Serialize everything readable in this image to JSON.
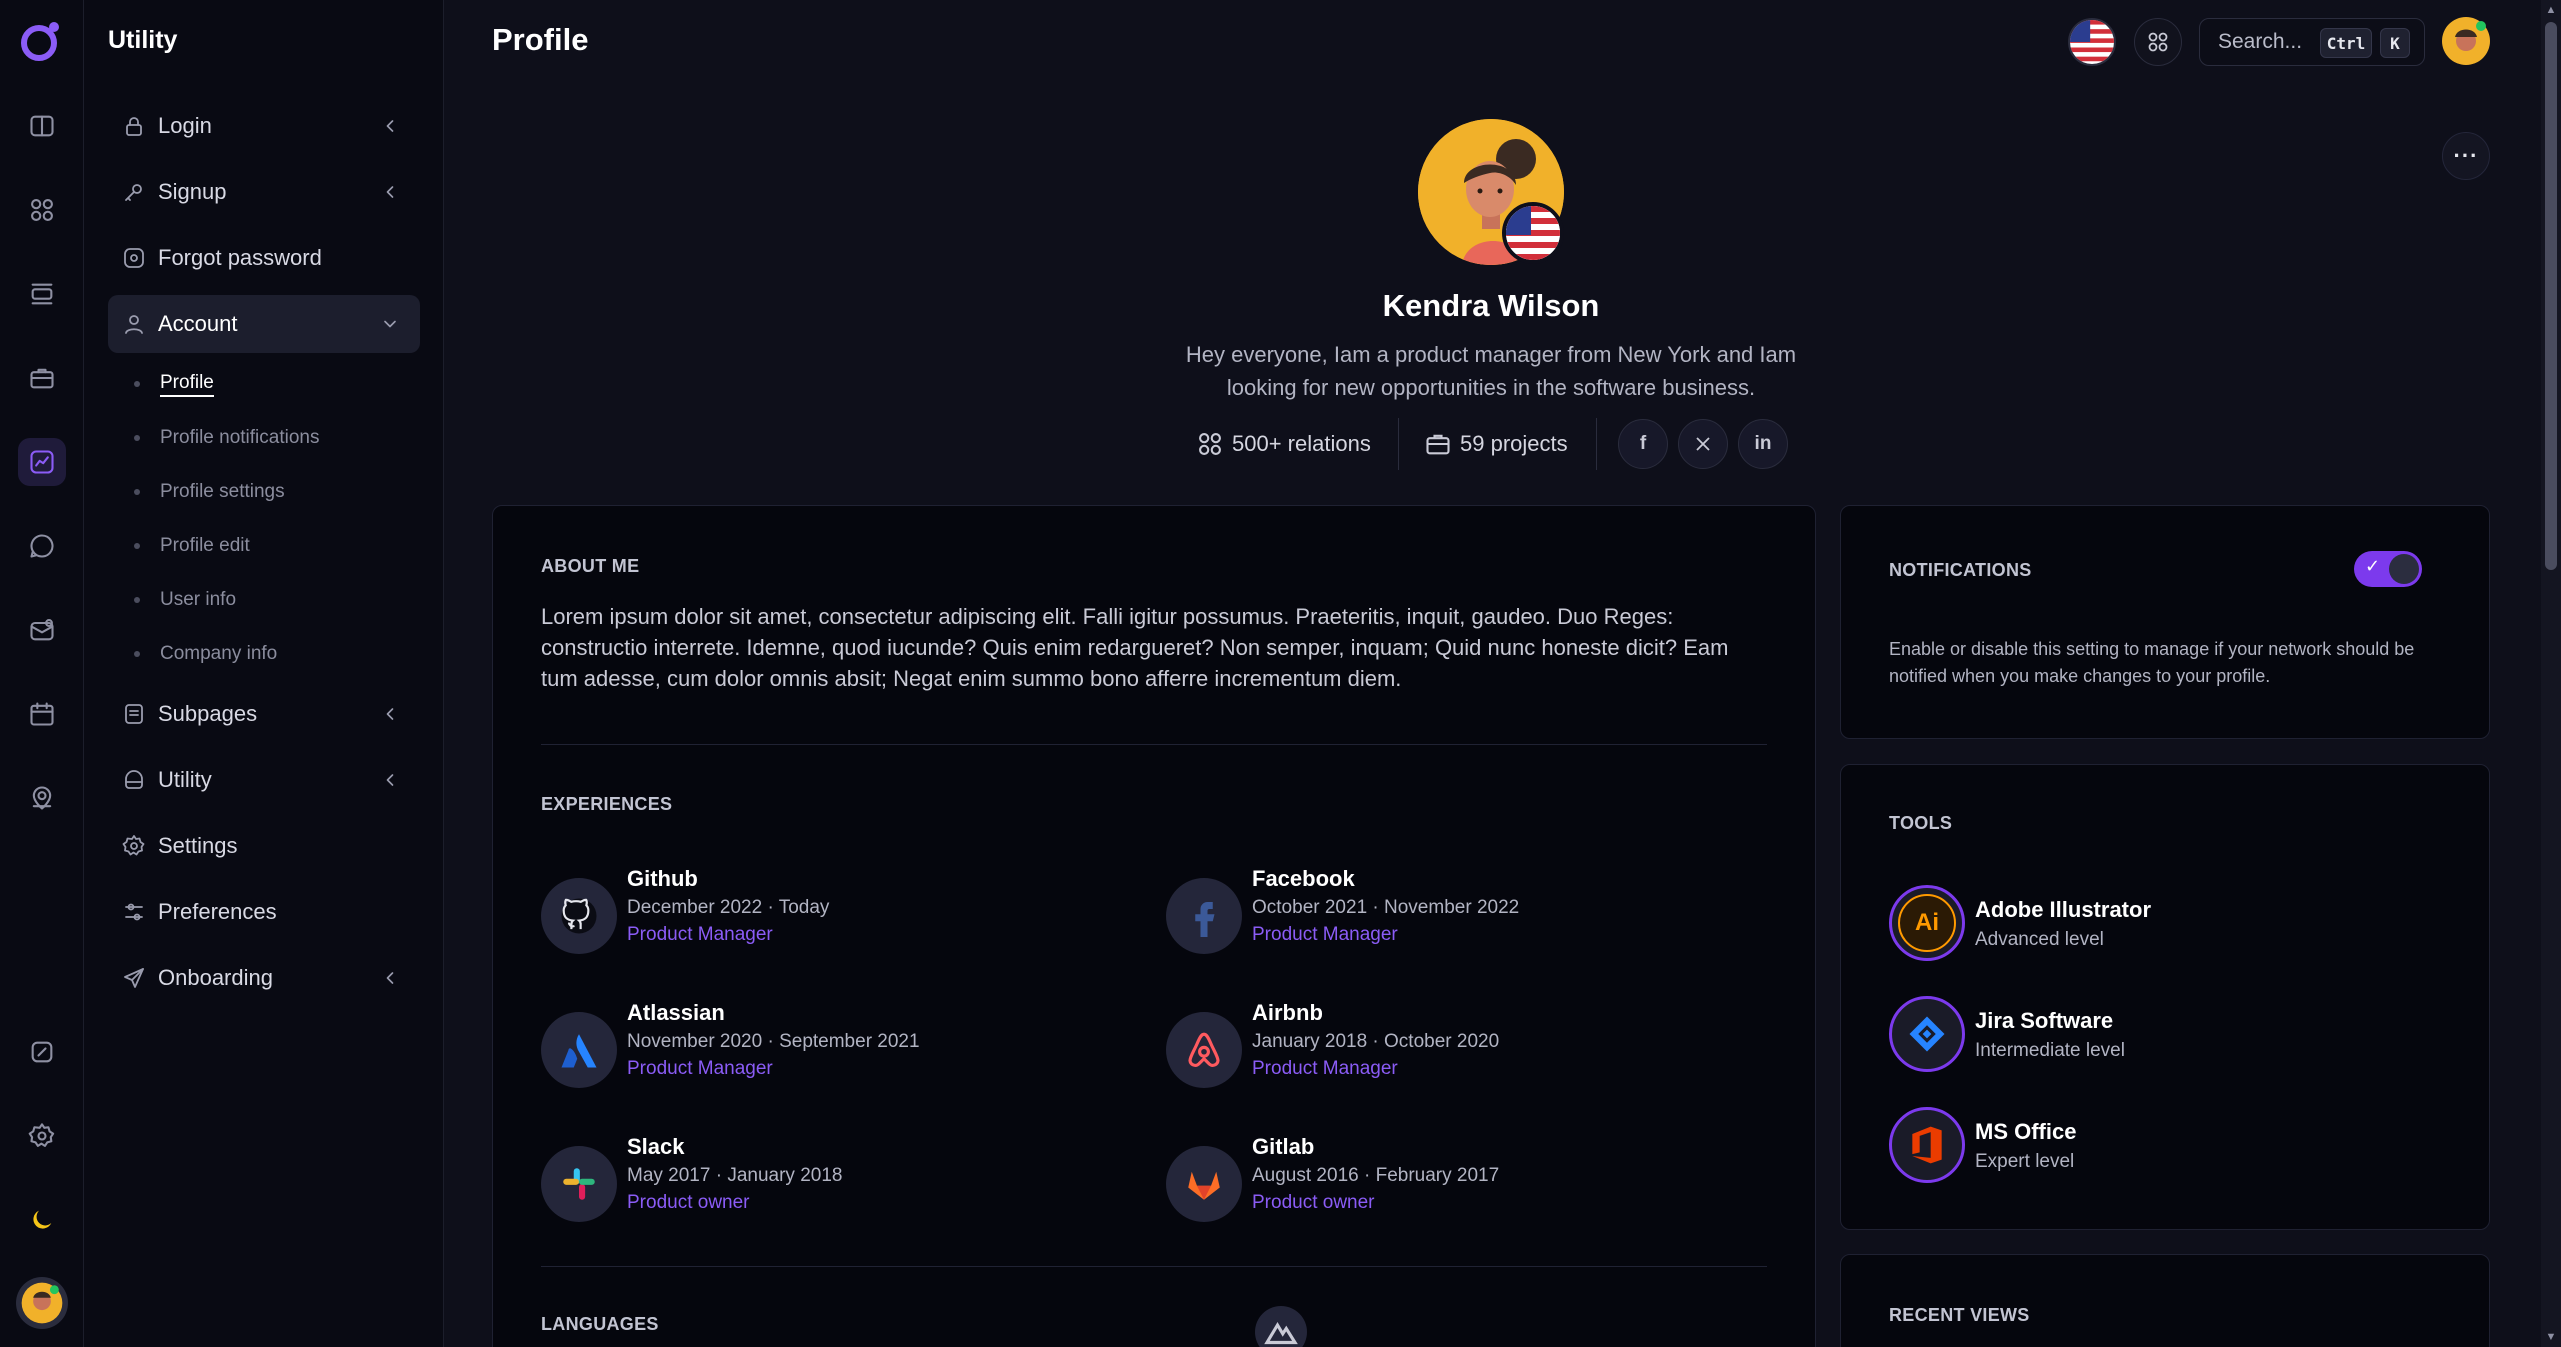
{
  "sidebar": {
    "title": "Utility",
    "items": [
      {
        "label": "Login",
        "icon": "lock-icon"
      },
      {
        "label": "Signup",
        "icon": "key-icon"
      },
      {
        "label": "Forgot password",
        "icon": "reset-icon"
      },
      {
        "label": "Account",
        "icon": "user-icon"
      },
      {
        "label": "Subpages",
        "icon": "pages-icon"
      },
      {
        "label": "Utility",
        "icon": "flask-icon"
      },
      {
        "label": "Settings",
        "icon": "gear-icon"
      },
      {
        "label": "Preferences",
        "icon": "sliders-icon"
      },
      {
        "label": "Onboarding",
        "icon": "send-icon"
      }
    ],
    "account_sub": [
      {
        "label": "Profile"
      },
      {
        "label": "Profile notifications"
      },
      {
        "label": "Profile settings"
      },
      {
        "label": "Profile edit"
      },
      {
        "label": "User info"
      },
      {
        "label": "Company info"
      }
    ]
  },
  "header": {
    "title": "Profile",
    "search_placeholder": "Search...",
    "kbd_ctrl": "Ctrl",
    "kbd_k": "K"
  },
  "profile": {
    "name": "Kendra Wilson",
    "bio": "Hey everyone, Iam a product manager from New York and Iam looking for new opportunities in the software business.",
    "relations": "500+ relations",
    "projects": "59 projects",
    "more": "···"
  },
  "about": {
    "heading": "ABOUT ME",
    "text": "Lorem ipsum dolor sit amet, consectetur adipiscing elit. Falli igitur possumus. Praeteritis, inquit, gaudeo. Duo Reges: constructio interrete. Idemne, quod iucunde? Quis enim redargueret? Non semper, inquam; Quid nunc honeste dicit? Eam tum adesse, cum dolor omnis absit; Negat enim summo bono afferre incrementum diem."
  },
  "experiences": {
    "heading": "EXPERIENCES",
    "items": [
      {
        "company": "Github",
        "dates": "December 2022 · Today",
        "role": "Product Manager"
      },
      {
        "company": "Facebook",
        "dates": "October 2021 · November 2022",
        "role": "Product Manager"
      },
      {
        "company": "Atlassian",
        "dates": "November 2020 · September 2021",
        "role": "Product Manager"
      },
      {
        "company": "Airbnb",
        "dates": "January 2018 · October 2020",
        "role": "Product Manager"
      },
      {
        "company": "Slack",
        "dates": "May 2017 · January 2018",
        "role": "Product owner"
      },
      {
        "company": "Gitlab",
        "dates": "August 2016 · February 2017",
        "role": "Product owner"
      }
    ]
  },
  "languages": {
    "heading": "LANGUAGES"
  },
  "notifications": {
    "heading": "NOTIFICATIONS",
    "enabled": true,
    "text": "Enable or disable this setting to manage if your network should be notified when you make changes to your profile."
  },
  "tools": {
    "heading": "TOOLS",
    "items": [
      {
        "name": "Adobe Illustrator",
        "level": "Advanced level",
        "badge": "Ai"
      },
      {
        "name": "Jira Software",
        "level": "Intermediate level"
      },
      {
        "name": "MS Office",
        "level": "Expert level"
      }
    ]
  },
  "recent_views": {
    "heading": "RECENT VIEWS"
  },
  "colors": {
    "accent": "#8b5cf6",
    "background": "#0e0f1a",
    "card": "#05060d"
  }
}
